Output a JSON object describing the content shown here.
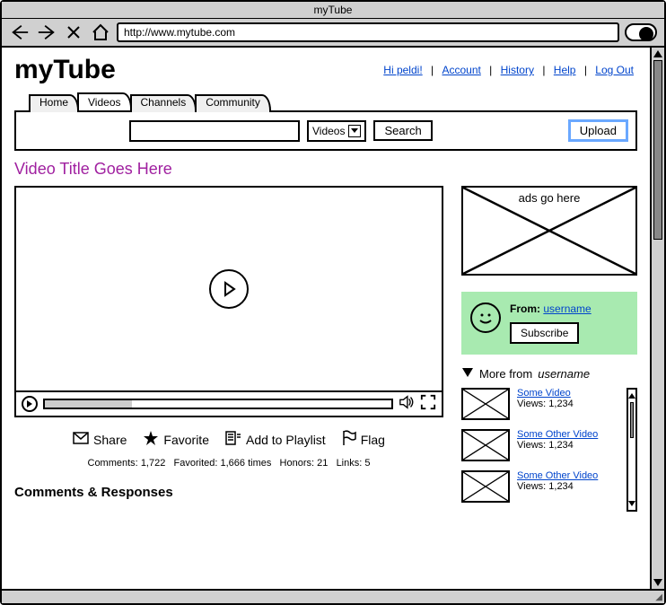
{
  "window": {
    "title": "myTube"
  },
  "browser": {
    "url": "http://www.mytube.com"
  },
  "logo": "myTube",
  "topnav": {
    "greeting": "Hi peldi!",
    "account": "Account",
    "history": "History",
    "help": "Help",
    "logout": "Log Out"
  },
  "tabs": {
    "home": "Home",
    "videos": "Videos",
    "channels": "Channels",
    "community": "Community"
  },
  "search": {
    "select_value": "Videos",
    "search_btn": "Search",
    "upload_btn": "Upload"
  },
  "video": {
    "title": "Video Title Goes Here"
  },
  "actions": {
    "share": "Share",
    "favorite": "Favorite",
    "playlist": "Add to Playlist",
    "flag": "Flag"
  },
  "stats": {
    "comments_label": "Comments:",
    "comments": "1,722",
    "favorited_label": "Favorited:",
    "favorited": "1,666 times",
    "honors_label": "Honors:",
    "honors": "21",
    "links_label": "Links:",
    "links": "5"
  },
  "comments_heading": "Comments & Responses",
  "sidebar": {
    "ad_text": "ads go here",
    "from_label": "From:",
    "from_user": "username",
    "subscribe": "Subscribe",
    "more_prefix": "More from",
    "more_user": "username",
    "related": [
      {
        "title": "Some Video",
        "views_label": "Views:",
        "views": "1,234"
      },
      {
        "title": "Some Other Video",
        "views_label": "Views:",
        "views": "1,234"
      },
      {
        "title": "Some Other Video",
        "views_label": "Views:",
        "views": "1,234"
      }
    ]
  }
}
